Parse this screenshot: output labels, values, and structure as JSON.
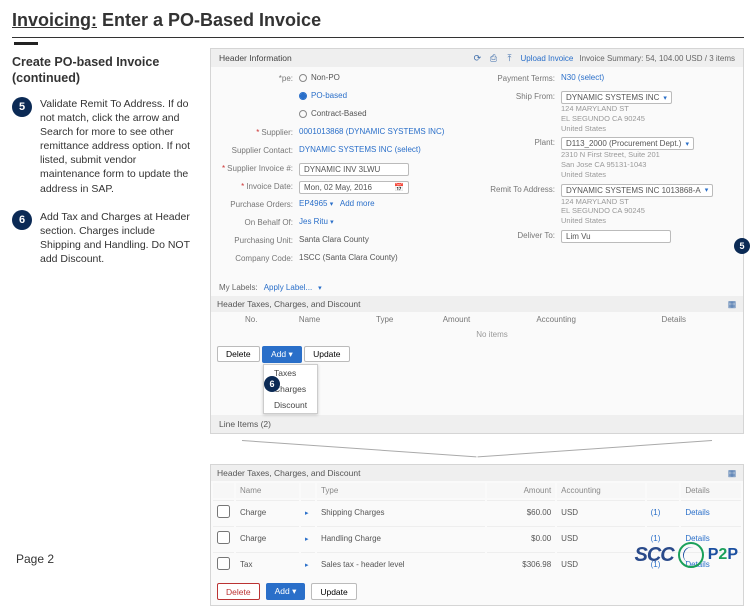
{
  "title": {
    "lead": "Invoicing:",
    "rest": " Enter a PO-Based Invoice"
  },
  "subtitle": "Create PO-based Invoice (continued)",
  "steps": {
    "s5": {
      "num": "5",
      "text": "Validate Remit To Address. If do not match, click the arrow and Search for more to see other remittance address option. If not listed, submit vendor maintenance form to update the address in SAP."
    },
    "s6": {
      "num": "6",
      "text": "Add Tax and Charges at Header section. Charges include Shipping and Handling. Do NOT add Discount."
    }
  },
  "shot": {
    "headerInfo": "Header Information",
    "hdrRight": {
      "upload": "Upload Invoice",
      "invoiceSummary": "Invoice Summary: 54, 104.00 USD / 3 items"
    },
    "left": {
      "typeLabel": "*pe:",
      "typeNonPO": "Non-PO",
      "typePO": "PO-based",
      "typeContract": "Contract-Based",
      "supplierLabel": "Supplier:",
      "supplierVal": "0001013868 (DYNAMIC SYSTEMS INC)",
      "supplierContactLabel": "Supplier Contact:",
      "supplierContactVal": "DYNAMIC SYSTEMS INC (select)",
      "supplierInvLabel": "Supplier Invoice #:",
      "supplierInvVal": "DYNAMIC INV 3LWU",
      "invDateLabel": "Invoice Date:",
      "invDateVal": "Mon, 02 May, 2016",
      "poLabel": "Purchase Orders:",
      "poVal": "EP4965",
      "addMore": "Add more",
      "onBehalfLabel": "On Behalf Of:",
      "onBehalfVal": "Jes Ritu",
      "purchUnitLabel": "Purchasing Unit:",
      "purchUnitVal": "Santa Clara County",
      "companyLabel": "Company Code:",
      "companyVal": "1SCC (Santa Clara County)"
    },
    "right": {
      "paymentTermsLabel": "Payment Terms:",
      "paymentTermsVal": "N30 (select)",
      "shipFromLabel": "Ship From:",
      "shipFromVal": "DYNAMIC SYSTEMS INC",
      "shipFromAddr1": "124 MARYLAND ST",
      "shipFromAddr2": "EL SEGUNDO CA 90245",
      "shipFromAddr3": "United States",
      "plantLabel": "Plant:",
      "plantVal": "D113_2000 (Procurement Dept.)",
      "plantAddr1": "2310 N First Street, Suite 201",
      "plantAddr2": "San Jose CA 95131-1043",
      "plantAddr3": "United States",
      "remitLabel": "Remit To Address:",
      "remitVal": "DYNAMIC SYSTEMS INC 1013868-A",
      "remitAddr1": "124 MARYLAND ST",
      "remitAddr2": "EL SEGUNDO CA 90245",
      "remitAddr3": "United States",
      "deliverLabel": "Deliver To:",
      "deliverVal": "Lim Vu"
    },
    "labels": {
      "my": "My Labels:",
      "apply": "Apply Label..."
    },
    "taxHead": "Header Taxes, Charges, and Discount",
    "taxCols": {
      "no": "No.",
      "name": "Name",
      "type": "Type",
      "amount": "Amount",
      "accounting": "Accounting",
      "details": "Details"
    },
    "noItems": "No items",
    "topBtns": {
      "delete": "Delete",
      "add": "Add ▾",
      "update": "Update"
    },
    "menu": {
      "taxes": "Taxes",
      "charges": "Charges",
      "discount": "Discount"
    },
    "lineItems": "Line Items (2)",
    "detailRows": [
      {
        "name": "Charge",
        "type": "Shipping Charges",
        "amount": "$60.00",
        "acct": "USD",
        "ln": "(1)",
        "d": "Details"
      },
      {
        "name": "Charge",
        "type": "Handling Charge",
        "amount": "$0.00",
        "acct": "USD",
        "ln": "(1)",
        "d": "Details"
      },
      {
        "name": "Tax",
        "type": "Sales tax - header level",
        "amount": "$306.98",
        "acct": "USD",
        "ln": "(1)",
        "d": "Details"
      }
    ],
    "detailBtns": {
      "delete": "Delete",
      "add": "Add ▾",
      "update": "Update"
    }
  },
  "callouts": {
    "c5": "5",
    "c6": "6"
  },
  "pageNum": "Page 2",
  "logo": {
    "scc": "SCC",
    "p2p_p1": "P",
    "p2p_2": "2",
    "p2p_p2": "P"
  }
}
